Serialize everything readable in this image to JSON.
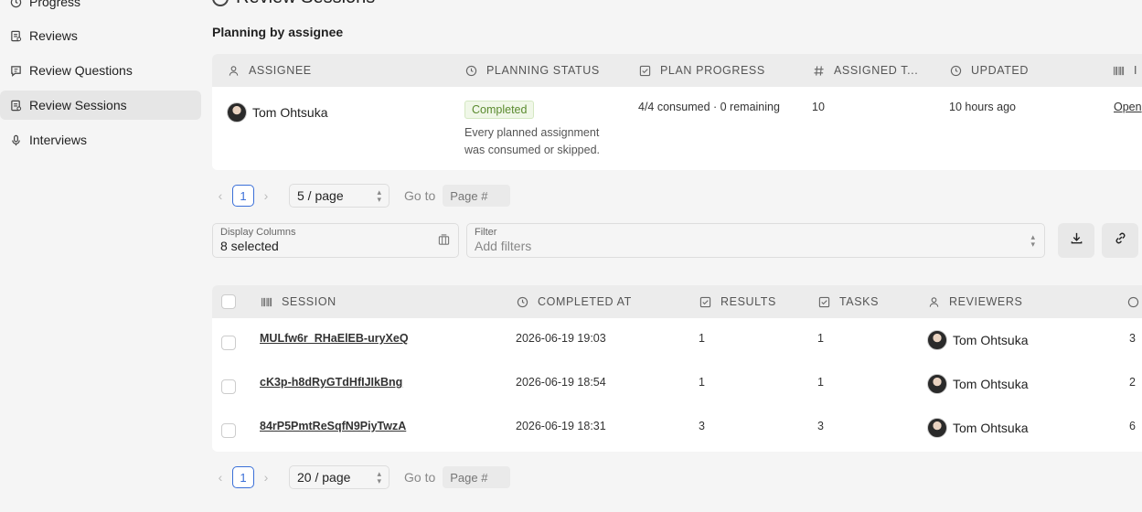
{
  "sidebar": {
    "items": [
      {
        "label": "Progress",
        "icon": "progress-icon"
      },
      {
        "label": "Reviews",
        "icon": "document-icon"
      },
      {
        "label": "Review Questions",
        "icon": "question-icon"
      },
      {
        "label": "Review Sessions",
        "icon": "document-icon",
        "active": true
      },
      {
        "label": "Interviews",
        "icon": "microphone-icon"
      }
    ]
  },
  "page": {
    "title": "Review Sessions",
    "planning_section_title": "Planning by assignee"
  },
  "planning_table": {
    "headers": [
      "ASSIGNEE",
      "PLANNING STATUS",
      "PLAN PROGRESS",
      "ASSIGNED T...",
      "UPDATED",
      "I"
    ],
    "rows": [
      {
        "assignee": "Tom Ohtsuka",
        "status": "Completed",
        "status_desc": "Every planned assignment was consumed or skipped.",
        "plan_progress": "4/4 consumed · 0 remaining",
        "assigned": "10",
        "updated": "10 hours ago",
        "link": "Open"
      }
    ]
  },
  "pager_top": {
    "page": "1",
    "size": "5 / page",
    "goto_label": "Go to",
    "goto_placeholder": "Page #"
  },
  "filters": {
    "display_columns_label": "Display Columns",
    "display_columns_value": "8 selected",
    "filter_label": "Filter",
    "filter_placeholder": "Add filters"
  },
  "sessions_table": {
    "headers": [
      "SESSION",
      "COMPLETED AT",
      "RESULTS",
      "TASKS",
      "REVIEWERS"
    ],
    "rows": [
      {
        "session": "MULfw6r_RHaElEB-uryXeQ",
        "completed": "2026-06-19 19:03",
        "results": "1",
        "tasks": "1",
        "reviewer": "Tom Ohtsuka",
        "extra": "3"
      },
      {
        "session": "cK3p-h8dRyGTdHfIJIkBng",
        "completed": "2026-06-19 18:54",
        "results": "1",
        "tasks": "1",
        "reviewer": "Tom Ohtsuka",
        "extra": "2"
      },
      {
        "session": "84rP5PmtReSqfN9PiyTwzA",
        "completed": "2026-06-19 18:31",
        "results": "3",
        "tasks": "3",
        "reviewer": "Tom Ohtsuka",
        "extra": "6"
      }
    ]
  },
  "pager_bottom": {
    "page": "1",
    "size": "20 / page",
    "goto_label": "Go to",
    "goto_placeholder": "Page #"
  }
}
